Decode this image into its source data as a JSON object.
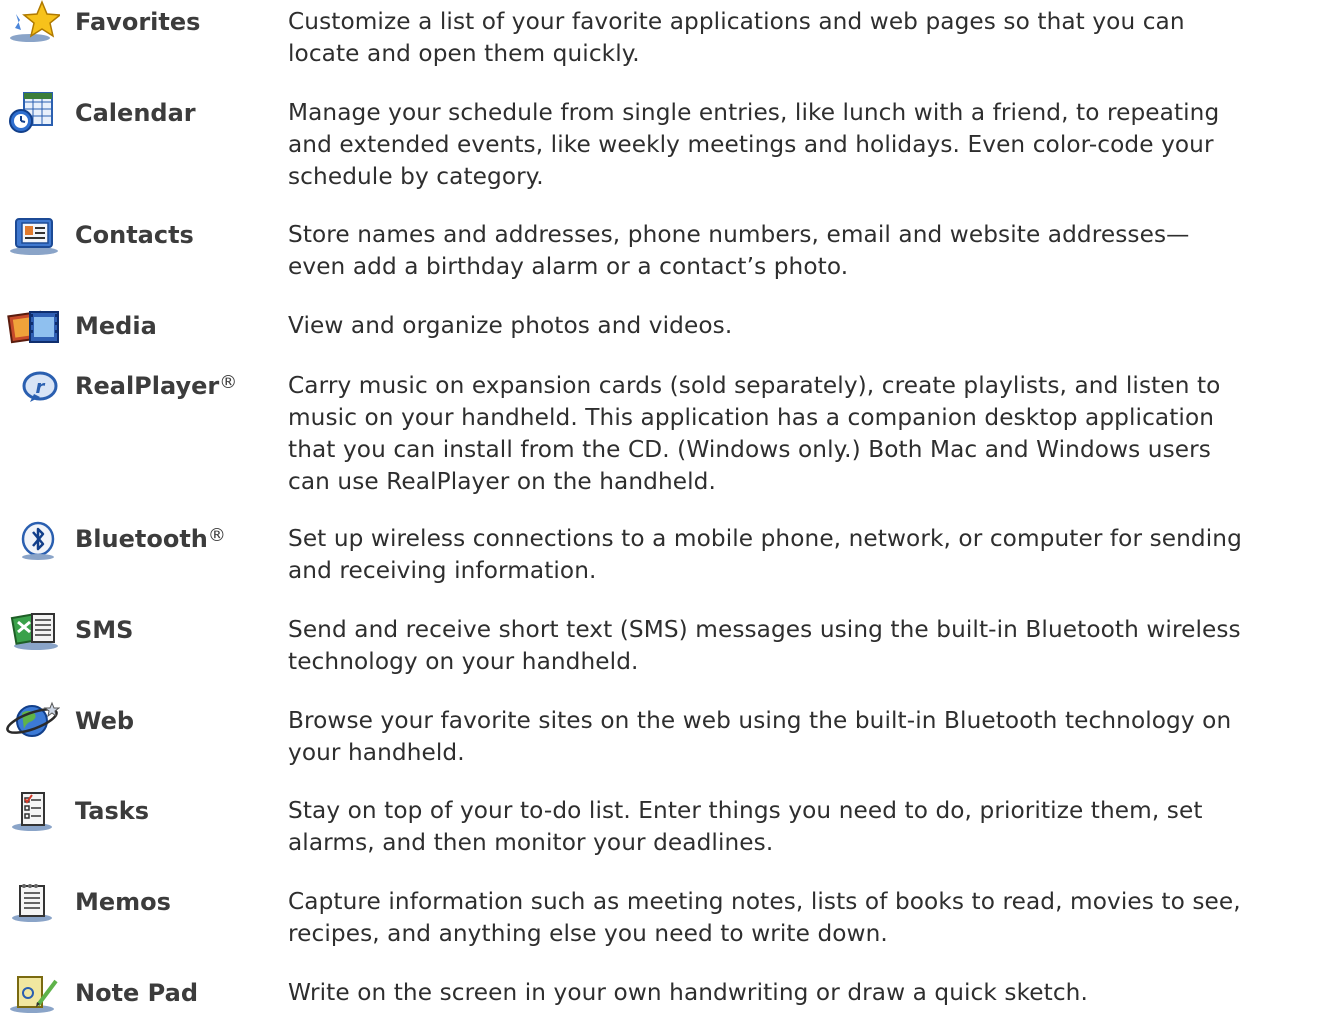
{
  "apps": [
    {
      "name": "Favorites",
      "reg": "",
      "icon": "favorites-star-icon",
      "lines": [
        "Customize a list of your favorite applications and web pages so that you can",
        "locate and open them quickly."
      ]
    },
    {
      "name": "Calendar",
      "reg": "",
      "icon": "calendar-icon",
      "lines": [
        "Manage your schedule from single entries, like lunch with a friend, to repeating",
        "and extended events, like weekly meetings and holidays. Even color-code your",
        "schedule by category."
      ]
    },
    {
      "name": "Contacts",
      "reg": "",
      "icon": "contacts-icon",
      "lines": [
        "Store names and addresses, phone numbers, email and website addresses—",
        "even add a birthday alarm or a contact’s photo."
      ]
    },
    {
      "name": "Media",
      "reg": "",
      "icon": "media-icon",
      "lines": [
        "View and organize photos and videos."
      ]
    },
    {
      "name": "RealPlayer",
      "reg": "®",
      "icon": "realplayer-icon",
      "lines": [
        "Carry music on expansion cards (sold separately), create playlists, and listen to",
        "music on your handheld. This application has a companion desktop application",
        "that you can install from the CD. (Windows only.) Both Mac and Windows users",
        "can use RealPlayer on the handheld."
      ]
    },
    {
      "name": "Bluetooth",
      "reg": "®",
      "icon": "bluetooth-icon",
      "lines": [
        "Set up wireless connections to a mobile phone, network, or computer for sending",
        "and receiving information."
      ]
    },
    {
      "name": "SMS",
      "reg": "",
      "icon": "sms-icon",
      "lines": [
        "Send and receive short text (SMS) messages using the built-in Bluetooth wireless",
        "technology on your handheld."
      ]
    },
    {
      "name": "Web",
      "reg": "",
      "icon": "web-globe-icon",
      "lines": [
        "Browse your favorite sites on the web using the built-in Bluetooth technology on",
        "your handheld."
      ]
    },
    {
      "name": "Tasks",
      "reg": "",
      "icon": "tasks-checklist-icon",
      "lines": [
        "Stay on top of your to-do list. Enter things you need to do, prioritize them, set",
        "alarms, and then monitor your deadlines."
      ]
    },
    {
      "name": "Memos",
      "reg": "",
      "icon": "memos-notepad-icon",
      "lines": [
        "Capture information such as meeting notes, lists of books to read, movies to see,",
        "recipes, and anything else you need to write down."
      ]
    },
    {
      "name": "Note Pad",
      "reg": "",
      "icon": "note-pad-icon",
      "lines": [
        "Write on the screen in your own handwriting or draw a quick sketch."
      ]
    }
  ]
}
